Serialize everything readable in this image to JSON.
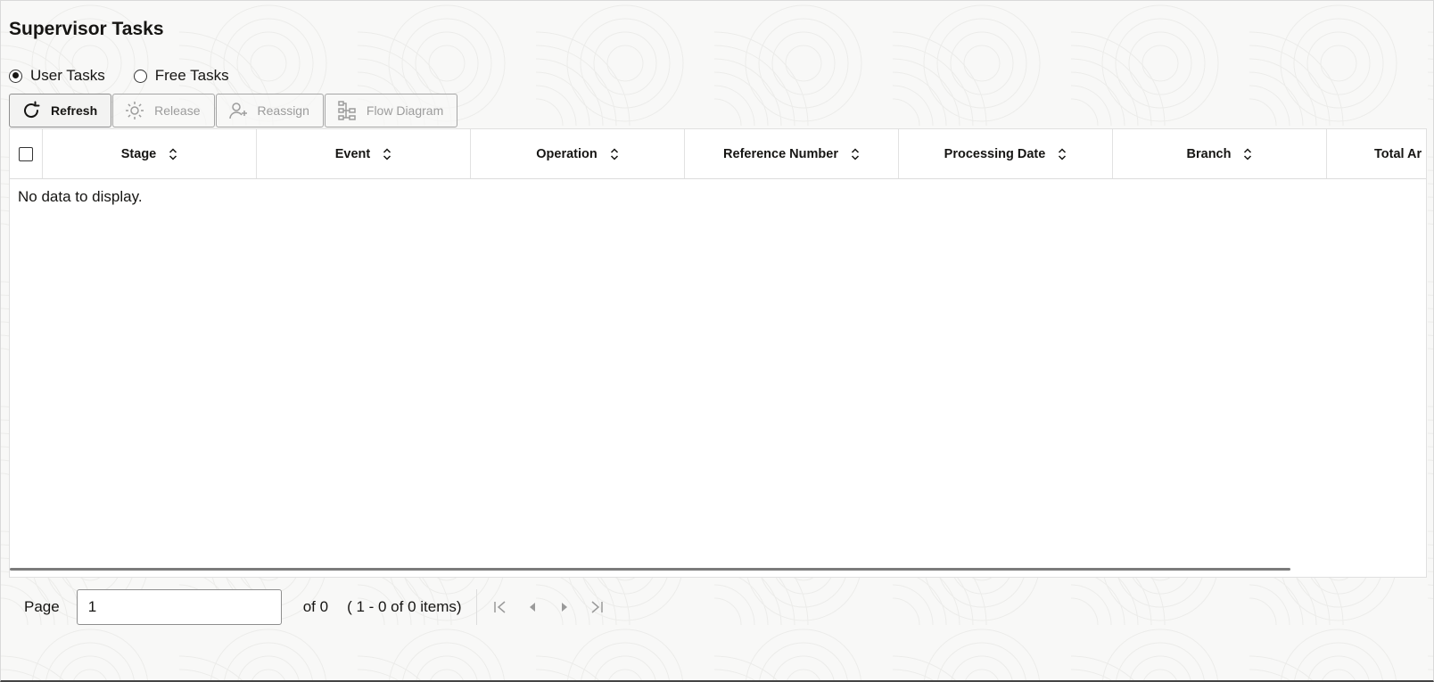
{
  "page": {
    "title": "Supervisor Tasks"
  },
  "task_type": {
    "options": [
      {
        "label": "User Tasks",
        "checked": true
      },
      {
        "label": "Free Tasks",
        "checked": false
      }
    ]
  },
  "toolbar": {
    "refresh_label": "Refresh",
    "release_label": "Release",
    "reassign_label": "Reassign",
    "flow_diagram_label": "Flow Diagram"
  },
  "table": {
    "columns": [
      "Stage",
      "Event",
      "Operation",
      "Reference Number",
      "Processing Date",
      "Branch",
      "Total Ar"
    ],
    "rows": [],
    "empty_message": "No data to display."
  },
  "pagination": {
    "page_label": "Page",
    "page_value": "1",
    "of_label": "of 0",
    "range_label": "( 1 - 0 of 0 items)"
  },
  "icons": {
    "refresh": "refresh-icon",
    "release": "gear-icon",
    "reassign": "user-plus-icon",
    "flow_diagram": "flow-diagram-icon",
    "sort": "sort-icon",
    "first": "first-page-icon",
    "prev": "previous-page-icon",
    "next": "next-page-icon",
    "last": "last-page-icon"
  },
  "colors": {
    "text": "#161513",
    "disabled_text": "#9c9c9c",
    "background": "#f8f8f7"
  }
}
